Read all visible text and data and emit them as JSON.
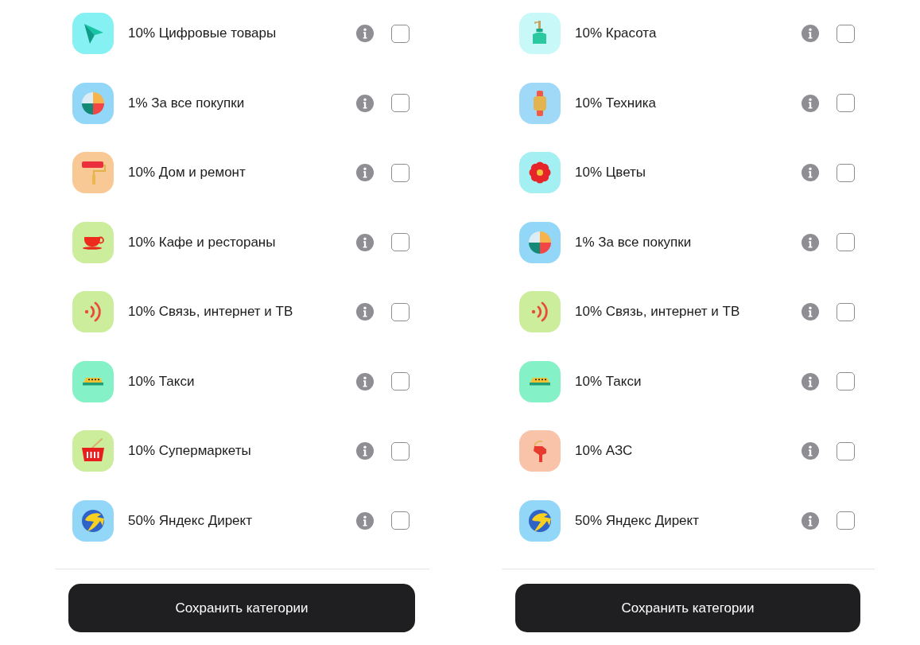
{
  "panels": [
    {
      "items": [
        {
          "kind": "digital",
          "label": "10% Цифровые товары",
          "checked": false
        },
        {
          "kind": "cashback",
          "label": "1% За все покупки",
          "checked": false
        },
        {
          "kind": "home",
          "label": "10% Дом и ремонт",
          "checked": false
        },
        {
          "kind": "cafe",
          "label": "10% Кафе и рестораны",
          "checked": false
        },
        {
          "kind": "telecom",
          "label": "10% Связь, интернет и ТВ",
          "checked": false
        },
        {
          "kind": "taxi",
          "label": "10% Такси",
          "checked": false
        },
        {
          "kind": "grocery",
          "label": "10% Супермаркеты",
          "checked": false
        },
        {
          "kind": "ads",
          "label": "50% Яндекс Директ",
          "checked": false
        }
      ],
      "button": "Сохранить категории"
    },
    {
      "items": [
        {
          "kind": "beauty",
          "label": "10% Красота",
          "checked": false
        },
        {
          "kind": "tech",
          "label": "10% Техника",
          "checked": false
        },
        {
          "kind": "flowers",
          "label": "10% Цветы",
          "checked": false
        },
        {
          "kind": "cashback",
          "label": "1% За все покупки",
          "checked": false
        },
        {
          "kind": "telecom",
          "label": "10% Связь, интернет и ТВ",
          "checked": false
        },
        {
          "kind": "taxi",
          "label": "10% Такси",
          "checked": false
        },
        {
          "kind": "fuel",
          "label": "10% АЗС",
          "checked": false
        },
        {
          "kind": "ads",
          "label": "50% Яндекс Директ",
          "checked": false
        }
      ],
      "button": "Сохранить категории"
    }
  ]
}
